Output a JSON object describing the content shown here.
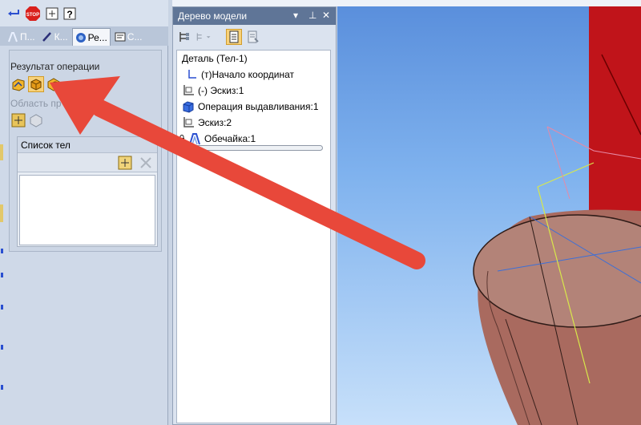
{
  "left_panel": {
    "tabs": [
      {
        "label": "П...",
        "icon": "surface-tab-icon"
      },
      {
        "label": "К...",
        "icon": "pen-tab-icon"
      },
      {
        "label": "Ре...",
        "icon": "result-tab-icon"
      },
      {
        "label": "С...",
        "icon": "properties-tab-icon"
      }
    ],
    "result_label": "Результат операции",
    "scope_label": "Область пр",
    "bodies_list_header": "Список тел"
  },
  "tree": {
    "title": "Дерево модели",
    "pin_glyph": "▾ ⊥ ✕",
    "items": [
      {
        "label": "Деталь (Тел-1)",
        "icon": ""
      },
      {
        "label": "(т)Начало координат",
        "icon": "origin-icon"
      },
      {
        "label": "(-) Эскиз:1",
        "icon": "sketch-icon"
      },
      {
        "label": "Операция выдавливания:1",
        "icon": "extrude-icon"
      },
      {
        "label": "Эскиз:2",
        "icon": "sketch-icon"
      },
      {
        "label": "Обечайка:1",
        "icon": "shell-icon"
      }
    ]
  },
  "colors": {
    "accent_arrow": "#e8483a",
    "tree_title_bg": "#5f7597",
    "model_red": "#c0141a",
    "model_body": "#a96a5f"
  }
}
